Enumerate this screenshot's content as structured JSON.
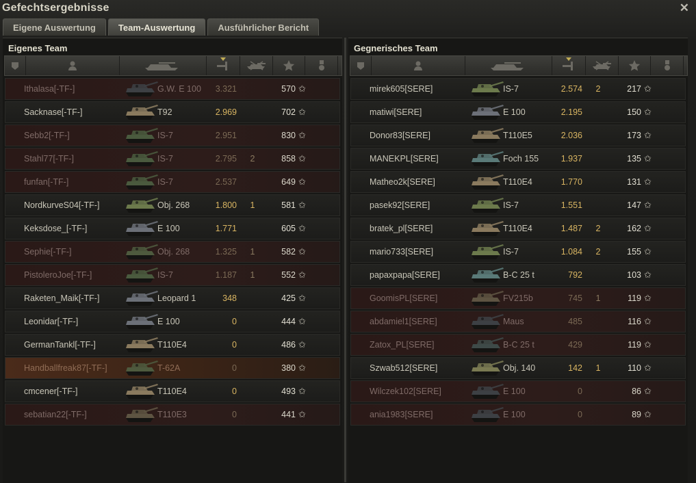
{
  "window": {
    "title": "Gefechtsergebnisse",
    "close_glyph": "✕"
  },
  "tabs": [
    {
      "label": "Eigene Auswertung"
    },
    {
      "label": "Team-Auswertung"
    },
    {
      "label": "Ausführlicher Bericht"
    }
  ],
  "own_team": {
    "title": "Eigenes Team",
    "rows": [
      {
        "player": "Ithalasa[-TF-]",
        "vehicle": "G.W. E 100",
        "damage": "3.321",
        "kills": "",
        "xp": "570",
        "state": "dead",
        "tank_color": "#3d4044"
      },
      {
        "player": "Sacknase[-TF-]",
        "vehicle": "T92",
        "damage": "2.969",
        "kills": "",
        "xp": "702",
        "state": "alive",
        "tank_color": "#8a7a5e"
      },
      {
        "player": "Sebb2[-TF-]",
        "vehicle": "IS-7",
        "damage": "2.951",
        "kills": "",
        "xp": "830",
        "state": "dead",
        "tank_color": "#4a5a3e"
      },
      {
        "player": "Stahl77[-TF-]",
        "vehicle": "IS-7",
        "damage": "2.795",
        "kills": "2",
        "xp": "858",
        "state": "dead",
        "tank_color": "#4a5a3e"
      },
      {
        "player": "funfan[-TF-]",
        "vehicle": "IS-7",
        "damage": "2.537",
        "kills": "",
        "xp": "649",
        "state": "dead",
        "tank_color": "#4a5a3e"
      },
      {
        "player": "NordkurveS04[-TF-]",
        "vehicle": "Obj. 268",
        "damage": "1.800",
        "kills": "1",
        "xp": "581",
        "state": "alive",
        "tank_color": "#6c7a4c"
      },
      {
        "player": "Keksdose_[-TF-]",
        "vehicle": "E 100",
        "damage": "1.771",
        "kills": "",
        "xp": "605",
        "state": "alive",
        "tank_color": "#6c7078"
      },
      {
        "player": "Sephie[-TF-]",
        "vehicle": "Obj. 268",
        "damage": "1.325",
        "kills": "1",
        "xp": "582",
        "state": "dead",
        "tank_color": "#4e5a3e"
      },
      {
        "player": "PistoleroJoe[-TF-]",
        "vehicle": "IS-7",
        "damage": "1.187",
        "kills": "1",
        "xp": "552",
        "state": "dead",
        "tank_color": "#4a5a3e"
      },
      {
        "player": "Raketen_Maik[-TF-]",
        "vehicle": "Leopard 1",
        "damage": "348",
        "kills": "",
        "xp": "425",
        "state": "alive",
        "tank_color": "#6c7078"
      },
      {
        "player": "Leonidar[-TF-]",
        "vehicle": "E 100",
        "damage": "0",
        "kills": "",
        "xp": "444",
        "state": "alive",
        "tank_color": "#6c7078"
      },
      {
        "player": "GermanTankl[-TF-]",
        "vehicle": "T110E4",
        "damage": "0",
        "kills": "",
        "xp": "486",
        "state": "alive",
        "tank_color": "#8a7a5e"
      },
      {
        "player": "Handballfreak87[-TF-]",
        "vehicle": "T-62A",
        "damage": "0",
        "kills": "",
        "xp": "380",
        "state": "highlight",
        "tank_color": "#4e5a3e"
      },
      {
        "player": "cmcener[-TF-]",
        "vehicle": "T110E4",
        "damage": "0",
        "kills": "",
        "xp": "493",
        "state": "alive",
        "tank_color": "#8a7a5e"
      },
      {
        "player": "sebatian22[-TF-]",
        "vehicle": "T110E3",
        "damage": "0",
        "kills": "",
        "xp": "441",
        "state": "dead",
        "tank_color": "#5e5442"
      }
    ]
  },
  "enemy_team": {
    "title": "Gegnerisches Team",
    "rows": [
      {
        "player": "mirek605[SERE]",
        "vehicle": "IS-7",
        "damage": "2.574",
        "kills": "2",
        "xp": "217",
        "state": "alive",
        "tank_color": "#6c7a4c"
      },
      {
        "player": "matiwi[SERE]",
        "vehicle": "E 100",
        "damage": "2.195",
        "kills": "",
        "xp": "150",
        "state": "alive",
        "tank_color": "#6c7078"
      },
      {
        "player": "Donor83[SERE]",
        "vehicle": "T110E5",
        "damage": "2.036",
        "kills": "",
        "xp": "173",
        "state": "alive",
        "tank_color": "#8a7a5e"
      },
      {
        "player": "MANEKPL[SERE]",
        "vehicle": "Foch 155",
        "damage": "1.937",
        "kills": "",
        "xp": "135",
        "state": "alive",
        "tank_color": "#5a7a78"
      },
      {
        "player": "Matheo2k[SERE]",
        "vehicle": "T110E4",
        "damage": "1.770",
        "kills": "",
        "xp": "131",
        "state": "alive",
        "tank_color": "#8a7a5e"
      },
      {
        "player": "pasek92[SERE]",
        "vehicle": "IS-7",
        "damage": "1.551",
        "kills": "",
        "xp": "147",
        "state": "alive",
        "tank_color": "#6c7a4c"
      },
      {
        "player": "bratek_pl[SERE]",
        "vehicle": "T110E4",
        "damage": "1.487",
        "kills": "2",
        "xp": "162",
        "state": "alive",
        "tank_color": "#8a7a5e"
      },
      {
        "player": "mario733[SERE]",
        "vehicle": "IS-7",
        "damage": "1.084",
        "kills": "2",
        "xp": "155",
        "state": "alive",
        "tank_color": "#6c7a4c"
      },
      {
        "player": "papaxpapa[SERE]",
        "vehicle": "B-C 25 t",
        "damage": "792",
        "kills": "",
        "xp": "103",
        "state": "alive",
        "tank_color": "#5a7a78"
      },
      {
        "player": "GoomisPL[SERE]",
        "vehicle": "FV215b",
        "damage": "745",
        "kills": "1",
        "xp": "119",
        "state": "dead",
        "tank_color": "#5e5442"
      },
      {
        "player": "abdamiel1[SERE]",
        "vehicle": "Maus",
        "damage": "485",
        "kills": "",
        "xp": "116",
        "state": "dead",
        "tank_color": "#3d4044"
      },
      {
        "player": "Zatox_PL[SERE]",
        "vehicle": "B-C 25 t",
        "damage": "429",
        "kills": "",
        "xp": "119",
        "state": "dead",
        "tank_color": "#3e4a48"
      },
      {
        "player": "Szwab512[SERE]",
        "vehicle": "Obj. 140",
        "damage": "142",
        "kills": "1",
        "xp": "110",
        "state": "alive",
        "tank_color": "#7a7a52"
      },
      {
        "player": "Wilczek102[SERE]",
        "vehicle": "E 100",
        "damage": "0",
        "kills": "",
        "xp": "86",
        "state": "dead",
        "tank_color": "#3d4044"
      },
      {
        "player": "ania1983[SERE]",
        "vehicle": "E 100",
        "damage": "0",
        "kills": "",
        "xp": "89",
        "state": "dead",
        "tank_color": "#3d4044"
      }
    ]
  },
  "columns": [
    {
      "icon": "squad-icon"
    },
    {
      "icon": "player-icon"
    },
    {
      "icon": "vehicle-icon"
    },
    {
      "icon": "damage-icon",
      "sorted": true
    },
    {
      "icon": "kills-icon"
    },
    {
      "icon": "xp-star-icon"
    },
    {
      "icon": "medal-icon"
    }
  ],
  "star_glyph": "✩"
}
